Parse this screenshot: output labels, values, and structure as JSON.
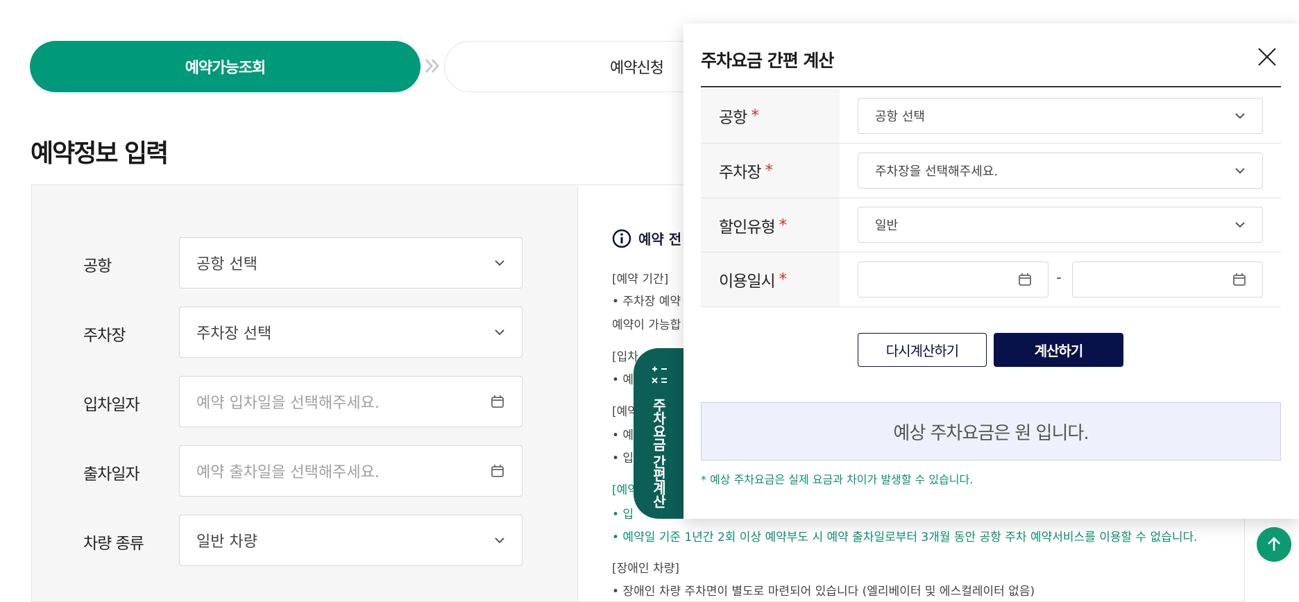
{
  "steps": {
    "active_label": "예약가능조회",
    "next_label": "예약신청"
  },
  "page_title": "예약정보 입력",
  "form": {
    "airport_label": "공항",
    "airport_value": "공항 선택",
    "parking_label": "주차장",
    "parking_value": "주차장 선택",
    "entry_label": "입차일자",
    "entry_placeholder": "예약 입차일을 선택해주세요.",
    "exit_label": "출차일자",
    "exit_placeholder": "예약 출차일을 선택해주세요.",
    "vehicle_label": "차량 종류",
    "vehicle_value": "일반 차량"
  },
  "info": {
    "heading": "예약 전",
    "line1": "[예약 기간]",
    "line2": "• 주차장 예약",
    "line3": "예약이 가능합",
    "line4": "[입차",
    "line5": "• 예",
    "line6": "[예약",
    "line7": "• 예",
    "line8": "• 입",
    "line9": "[예약",
    "line10": "• 입",
    "line11": "• 예약일 기준 1년간 2회 이상 예약부도 시 예약 출차일로부터 3개월 동안 공항 주차 예약서비스를 이용할 수 없습니다.",
    "line12": "[장애인 차량]",
    "line13": "• 장애인 차량 주차면이 별도로 마련되어 있습니다 (엘리베이터 및 에스컬레이터 없음)"
  },
  "calc_tab_label": "주차요금 간편계산",
  "modal": {
    "title": "주차요금 간편 계산",
    "rows": {
      "airport_label": "공항",
      "airport_value": "공항 선택",
      "parking_label": "주차장",
      "parking_value": "주차장을 선택해주세요.",
      "discount_label": "할인유형",
      "discount_value": "일반",
      "datetime_label": "이용일시",
      "range_separator": "-"
    },
    "required_mark": "*",
    "recalc_label": "다시계산하기",
    "calc_label": "계산하기",
    "result_text": "예상 주차요금은  원 입니다.",
    "note": "* 예상 주차요금은 실제 요금과 차이가 발생할 수 있습니다."
  },
  "colors": {
    "primary_green": "#009a7a",
    "navy": "#07114a",
    "required_red": "#d0312d",
    "teal_tab": "#0c5f57"
  },
  "icons": [
    "chevron-down-icon",
    "calendar-icon",
    "info-icon",
    "close-icon",
    "calculator-icon",
    "arrow-up-icon",
    "double-chevron-right-icon"
  ]
}
